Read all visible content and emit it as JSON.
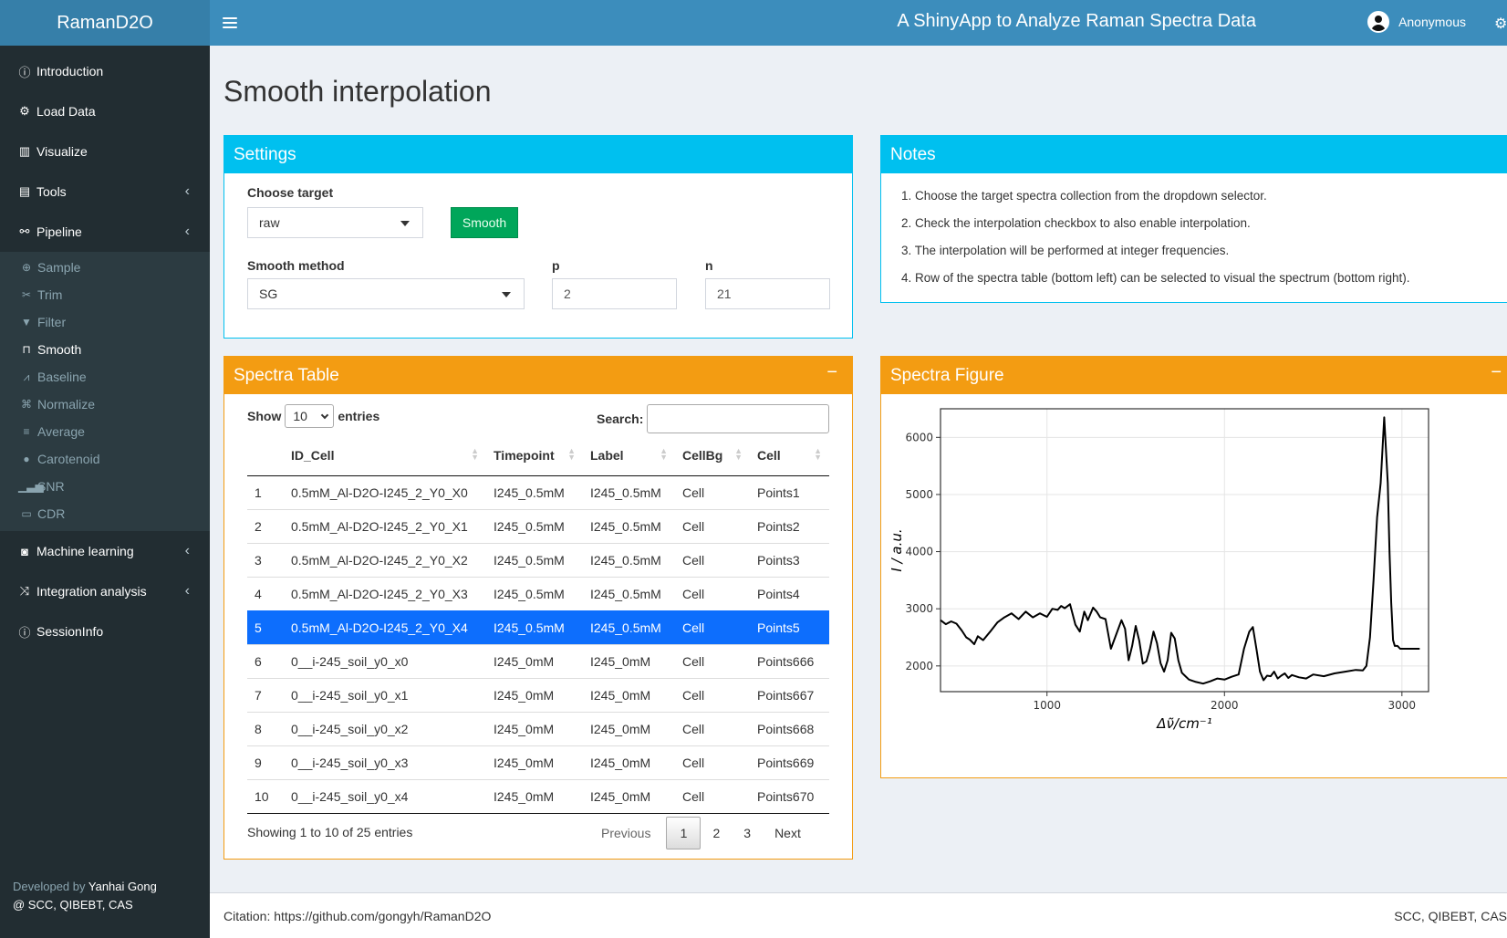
{
  "app": {
    "name": "RamanD2O",
    "title": "A ShinyApp to Analyze Raman Spectra Data",
    "user": "Anonymous"
  },
  "sidebar": {
    "items": [
      {
        "label": "Introduction",
        "icon": "info-circle-icon"
      },
      {
        "label": "Load Data",
        "icon": "gears-icon"
      },
      {
        "label": "Visualize",
        "icon": "bar-chart-icon"
      },
      {
        "label": "Tools",
        "icon": "toolbox-icon"
      },
      {
        "label": "Pipeline",
        "icon": "sitemap-icon"
      }
    ],
    "pipeline_items": [
      {
        "label": "Sample",
        "icon": "crosshair-icon"
      },
      {
        "label": "Trim",
        "icon": "scissors-icon"
      },
      {
        "label": "Filter",
        "icon": "filter-icon"
      },
      {
        "label": "Smooth",
        "icon": "wave-square-icon"
      },
      {
        "label": "Baseline",
        "icon": "line-chart-icon"
      },
      {
        "label": "Normalize",
        "icon": "compress-icon"
      },
      {
        "label": "Average",
        "icon": "align-left-icon"
      },
      {
        "label": "Carotenoid",
        "icon": "palette-icon"
      },
      {
        "label": "SNR",
        "icon": "signal-icon"
      },
      {
        "label": "CDR",
        "icon": "toggle-icon"
      }
    ],
    "bottom_items": [
      {
        "label": "Machine learning",
        "icon": "robot-icon"
      },
      {
        "label": "Integration analysis",
        "icon": "random-icon"
      },
      {
        "label": "SessionInfo",
        "icon": "info-circle-icon"
      }
    ],
    "developer_prefix": "Developed by",
    "developer_name": "Yanhai Gong",
    "developer_org": "@ SCC, QIBEBT, CAS"
  },
  "page_title": "Smooth interpolation",
  "settings": {
    "title": "Settings",
    "choose_target_label": "Choose target",
    "choose_target_value": "raw",
    "smooth_button": "Smooth",
    "method_label": "Smooth method",
    "method_value": "SG",
    "p_label": "p",
    "p_value": "2",
    "n_label": "n",
    "n_value": "21"
  },
  "notes": {
    "title": "Notes",
    "items": [
      "Choose the target spectra collection from the dropdown selector.",
      "Check the interpolation checkbox to also enable interpolation.",
      "The interpolation will be performed at integer frequencies.",
      "Row of the spectra table (bottom left) can be selected to visual the spectrum (bottom right)."
    ]
  },
  "table": {
    "title": "Spectra Table",
    "show_label": "Show",
    "show_value": "10",
    "entries_label": "entries",
    "search_label": "Search:",
    "columns": [
      "",
      "ID_Cell",
      "Timepoint",
      "Label",
      "CellBg",
      "Cell"
    ],
    "rows": [
      [
        "1",
        "0.5mM_Al-D2O-I245_2_Y0_X0",
        "I245_0.5mM",
        "I245_0.5mM",
        "Cell",
        "Points1"
      ],
      [
        "2",
        "0.5mM_Al-D2O-I245_2_Y0_X1",
        "I245_0.5mM",
        "I245_0.5mM",
        "Cell",
        "Points2"
      ],
      [
        "3",
        "0.5mM_Al-D2O-I245_2_Y0_X2",
        "I245_0.5mM",
        "I245_0.5mM",
        "Cell",
        "Points3"
      ],
      [
        "4",
        "0.5mM_Al-D2O-I245_2_Y0_X3",
        "I245_0.5mM",
        "I245_0.5mM",
        "Cell",
        "Points4"
      ],
      [
        "5",
        "0.5mM_Al-D2O-I245_2_Y0_X4",
        "I245_0.5mM",
        "I245_0.5mM",
        "Cell",
        "Points5"
      ],
      [
        "6",
        "0__i-245_soil_y0_x0",
        "I245_0mM",
        "I245_0mM",
        "Cell",
        "Points666"
      ],
      [
        "7",
        "0__i-245_soil_y0_x1",
        "I245_0mM",
        "I245_0mM",
        "Cell",
        "Points667"
      ],
      [
        "8",
        "0__i-245_soil_y0_x2",
        "I245_0mM",
        "I245_0mM",
        "Cell",
        "Points668"
      ],
      [
        "9",
        "0__i-245_soil_y0_x3",
        "I245_0mM",
        "I245_0mM",
        "Cell",
        "Points669"
      ],
      [
        "10",
        "0__i-245_soil_y0_x4",
        "I245_0mM",
        "I245_0mM",
        "Cell",
        "Points670"
      ]
    ],
    "selected_row": "5",
    "info": "Showing 1 to 10 of 25 entries",
    "pager": {
      "previous": "Previous",
      "pages": [
        "1",
        "2",
        "3"
      ],
      "current": "1",
      "next": "Next"
    }
  },
  "figure": {
    "title": "Spectra Figure"
  },
  "chart_data": {
    "type": "line",
    "xlabel": "Δν̃/cm⁻¹",
    "ylabel": "I / a.u.",
    "xlim": [
      400,
      3150
    ],
    "ylim": [
      1550,
      6500
    ],
    "x_ticks": [
      1000,
      2000,
      3000
    ],
    "y_ticks": [
      2000,
      3000,
      4000,
      5000,
      6000
    ],
    "grid": true,
    "series": [
      {
        "x": [
          400,
          430,
          460,
          490,
          520,
          545,
          565,
          590,
          610,
          640,
          680,
          720,
          760,
          800,
          840,
          880,
          920,
          960,
          1000,
          1030,
          1060,
          1080,
          1100,
          1130,
          1160,
          1185,
          1210,
          1230,
          1260,
          1280,
          1300,
          1330,
          1360,
          1390,
          1420,
          1440,
          1460,
          1480,
          1500,
          1520,
          1540,
          1560,
          1580,
          1600,
          1620,
          1640,
          1660,
          1680,
          1700,
          1720,
          1740,
          1760,
          1780,
          1800,
          1840,
          1880,
          1920,
          1960,
          2000,
          2040,
          2080,
          2110,
          2140,
          2160,
          2180,
          2200,
          2220,
          2240,
          2260,
          2280,
          2300,
          2320,
          2340,
          2360,
          2380,
          2420,
          2460,
          2500,
          2560,
          2620,
          2680,
          2740,
          2780,
          2800,
          2820,
          2840,
          2860,
          2880,
          2900,
          2920,
          2930,
          2940,
          2950,
          2960,
          2975,
          2990,
          3010,
          3030,
          3050,
          3070,
          3100
        ],
        "y": [
          2800,
          2730,
          2780,
          2740,
          2620,
          2500,
          2460,
          2380,
          2520,
          2450,
          2600,
          2760,
          2850,
          2920,
          2820,
          2950,
          2850,
          2920,
          2860,
          3000,
          2980,
          3050,
          3010,
          3080,
          2720,
          2600,
          2950,
          2800,
          3020,
          2950,
          2850,
          2820,
          2300,
          2550,
          2800,
          2650,
          2100,
          2350,
          2700,
          2440,
          2040,
          2080,
          2300,
          2600,
          2400,
          2050,
          1900,
          2100,
          2580,
          2480,
          2100,
          1880,
          1820,
          1760,
          1720,
          1690,
          1730,
          1780,
          1760,
          1810,
          1850,
          2300,
          2600,
          2680,
          2300,
          1900,
          1750,
          1830,
          1820,
          1900,
          1780,
          1830,
          1870,
          1790,
          1840,
          1800,
          1780,
          1850,
          1820,
          1870,
          1900,
          1930,
          1920,
          2000,
          2500,
          3500,
          4600,
          5200,
          6350,
          5200,
          4000,
          3100,
          2450,
          2350,
          2350,
          2300,
          2300,
          2300,
          2300,
          2300,
          2300
        ]
      }
    ]
  }
}
